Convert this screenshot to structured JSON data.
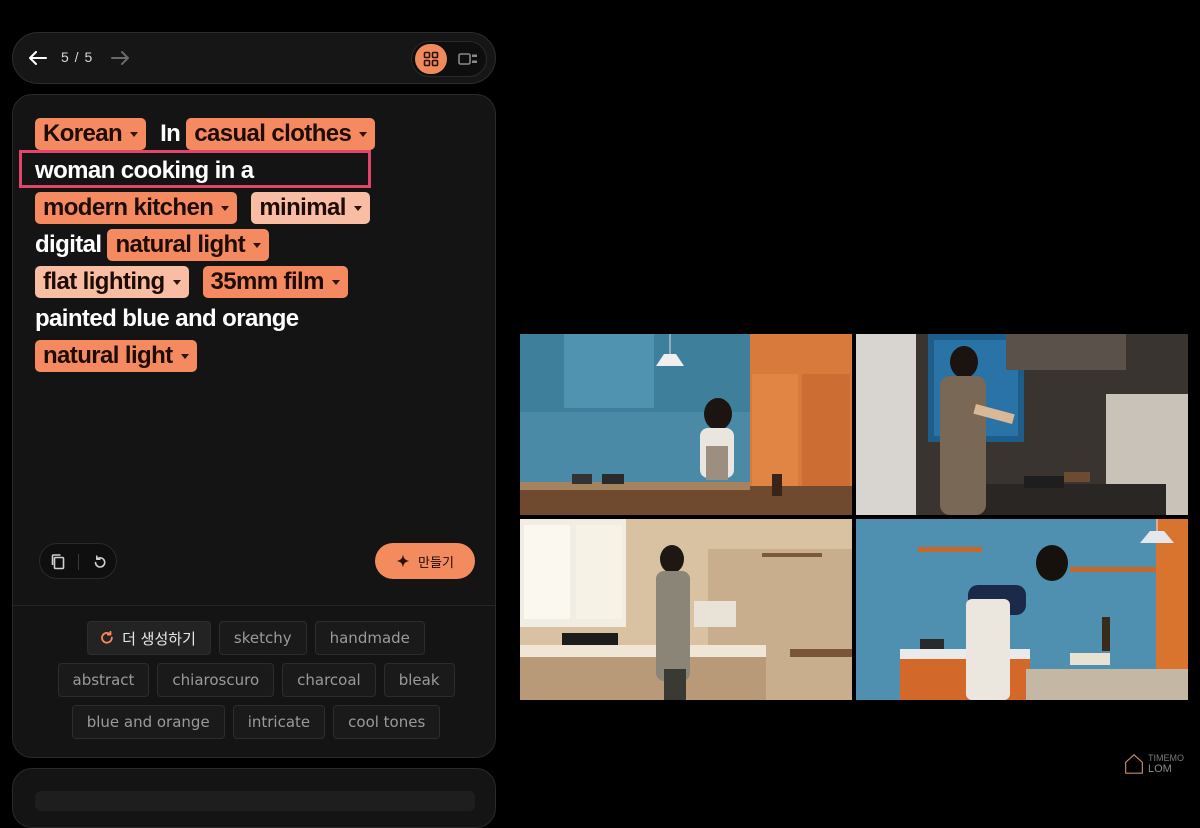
{
  "nav": {
    "counter": "5 / 5"
  },
  "prompt": {
    "chips": {
      "korean": "Korean",
      "casual_clothes": "casual clothes",
      "modern_kitchen": "modern kitchen",
      "minimal": "minimal",
      "natural_light_1": "natural light",
      "flat_lighting": "flat lighting",
      "film_35mm": "35mm film",
      "natural_light_2": "natural light"
    },
    "text": {
      "in": "In",
      "woman_cooking": "woman cooking in a",
      "digital": "digital",
      "painted": "painted blue and orange"
    }
  },
  "actions": {
    "make_label": "만들기"
  },
  "suggestions": {
    "more_label": "더 생성하기",
    "tags": [
      "sketchy",
      "handmade",
      "abstract",
      "chiaroscuro",
      "charcoal",
      "bleak",
      "blue and orange",
      "intricate",
      "cool tones"
    ]
  },
  "watermark": {
    "small": "TIMEMO",
    "big": "LOM"
  },
  "colors": {
    "accent": "#f5895f",
    "accent_light": "#f9bda3",
    "highlight": "#e2456a",
    "background": "#000000",
    "panel": "#141414"
  },
  "icons": [
    "arrow-left-icon",
    "arrow-right-icon",
    "grid-view-icon",
    "single-view-icon",
    "copy-icon",
    "reset-icon",
    "sparkle-icon",
    "refresh-icon",
    "house-logo-icon"
  ]
}
